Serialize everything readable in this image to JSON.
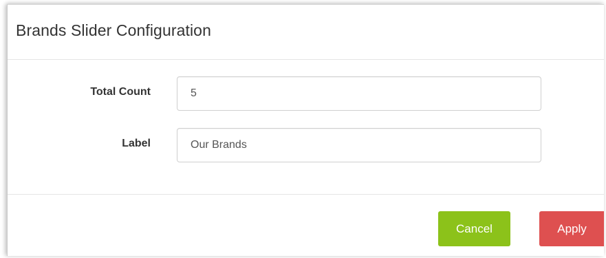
{
  "dialog": {
    "title": "Brands Slider Configuration"
  },
  "form": {
    "total_count": {
      "label": "Total Count",
      "value": "5"
    },
    "label_field": {
      "label": "Label",
      "value": "Our Brands"
    }
  },
  "footer": {
    "cancel_label": "Cancel",
    "apply_label": "Apply"
  },
  "colors": {
    "cancel_button": "#8cc21a",
    "apply_button": "#de5050"
  }
}
